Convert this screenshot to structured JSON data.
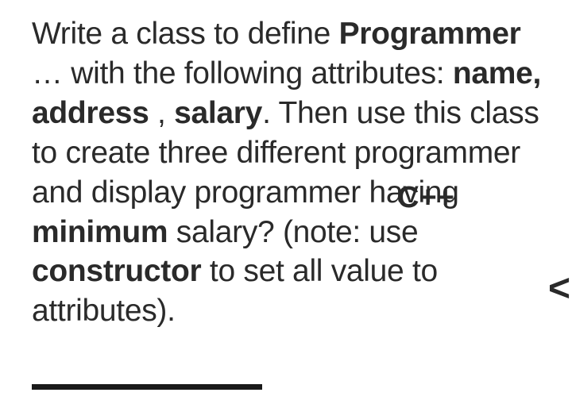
{
  "text": {
    "p1": "Write a class to define ",
    "b1": "Programmer",
    "p2": " … with the following attributes: ",
    "b2": "name, address",
    "p3": " , ",
    "b3": "salary",
    "p4": ". Then use this class to create three different programmer and display programmer having ",
    "b4": "minimum",
    "p5": " salary? (note: use ",
    "b5": "constructor",
    "p6": " to set all value to attributes)."
  },
  "lang": "C++",
  "chevron": "<"
}
